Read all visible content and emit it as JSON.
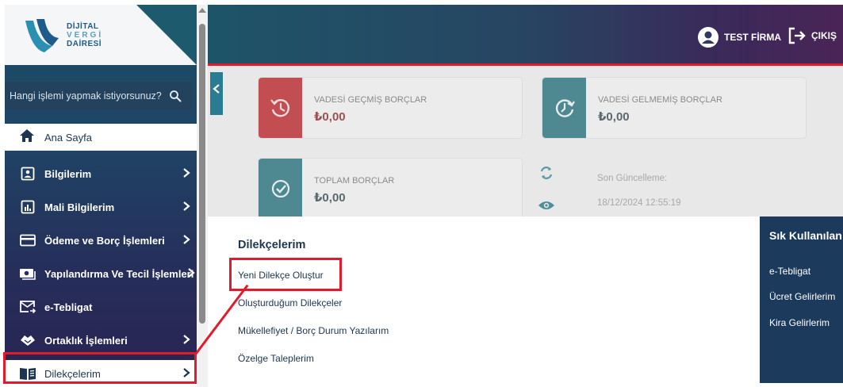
{
  "logo": {
    "line1": "DİJİTAL",
    "line2": "VERGİ",
    "line3": "DAİRESİ"
  },
  "search": {
    "placeholder": "Hangi işlemi yapmak istiyorsunuz?"
  },
  "sidebar": {
    "home": {
      "label": "Ana Sayfa",
      "icon": "home-icon"
    },
    "items": [
      {
        "label": "Bilgilerim",
        "icon": "id-card-icon"
      },
      {
        "label": "Mali Bilgilerim",
        "icon": "bar-chart-icon"
      },
      {
        "label": "Ödeme ve Borç İşlemleri",
        "icon": "credit-card-icon"
      },
      {
        "label": "Yapılandırma Ve Tecil İşlemleri",
        "icon": "money-icon"
      },
      {
        "label": "e-Tebligat",
        "icon": "mail-arrow-icon"
      },
      {
        "label": "Ortaklık İşlemleri",
        "icon": "handshake-icon"
      }
    ],
    "active": {
      "label": "Dilekçelerim",
      "icon": "book-icon"
    }
  },
  "header": {
    "user": "TEST FİRMA",
    "logout": "ÇIKIŞ"
  },
  "cards": {
    "overdue": {
      "title": "VADESİ GEÇMİŞ BORÇLAR",
      "value": "₺0,00"
    },
    "upcoming": {
      "title": "VADESİ GELMEMİŞ BORÇLAR",
      "value": "₺0,00"
    },
    "total": {
      "title": "TOPLAM BORÇLAR",
      "value": "₺0,00"
    }
  },
  "update": {
    "label": "Son Güncelleme:",
    "date": "18/12/2024 12:55:19"
  },
  "panel": {
    "title": "Dilekçelerim",
    "links": [
      "Yeni Dilekçe Oluştur",
      "Oluşturduğum Dilekçeler",
      "Mükellefiyet / Borç Durum Yazılarım",
      "Özelge Taleplerim"
    ]
  },
  "frequent": {
    "title": "Sık Kullanılan",
    "links": [
      "e-Tebligat",
      "Ücret Gelirlerim",
      "Kira Gelirlerim"
    ]
  },
  "colors": {
    "accent": "#e21b2c",
    "navy": "#1d3550",
    "teal": "#2a7c93"
  }
}
